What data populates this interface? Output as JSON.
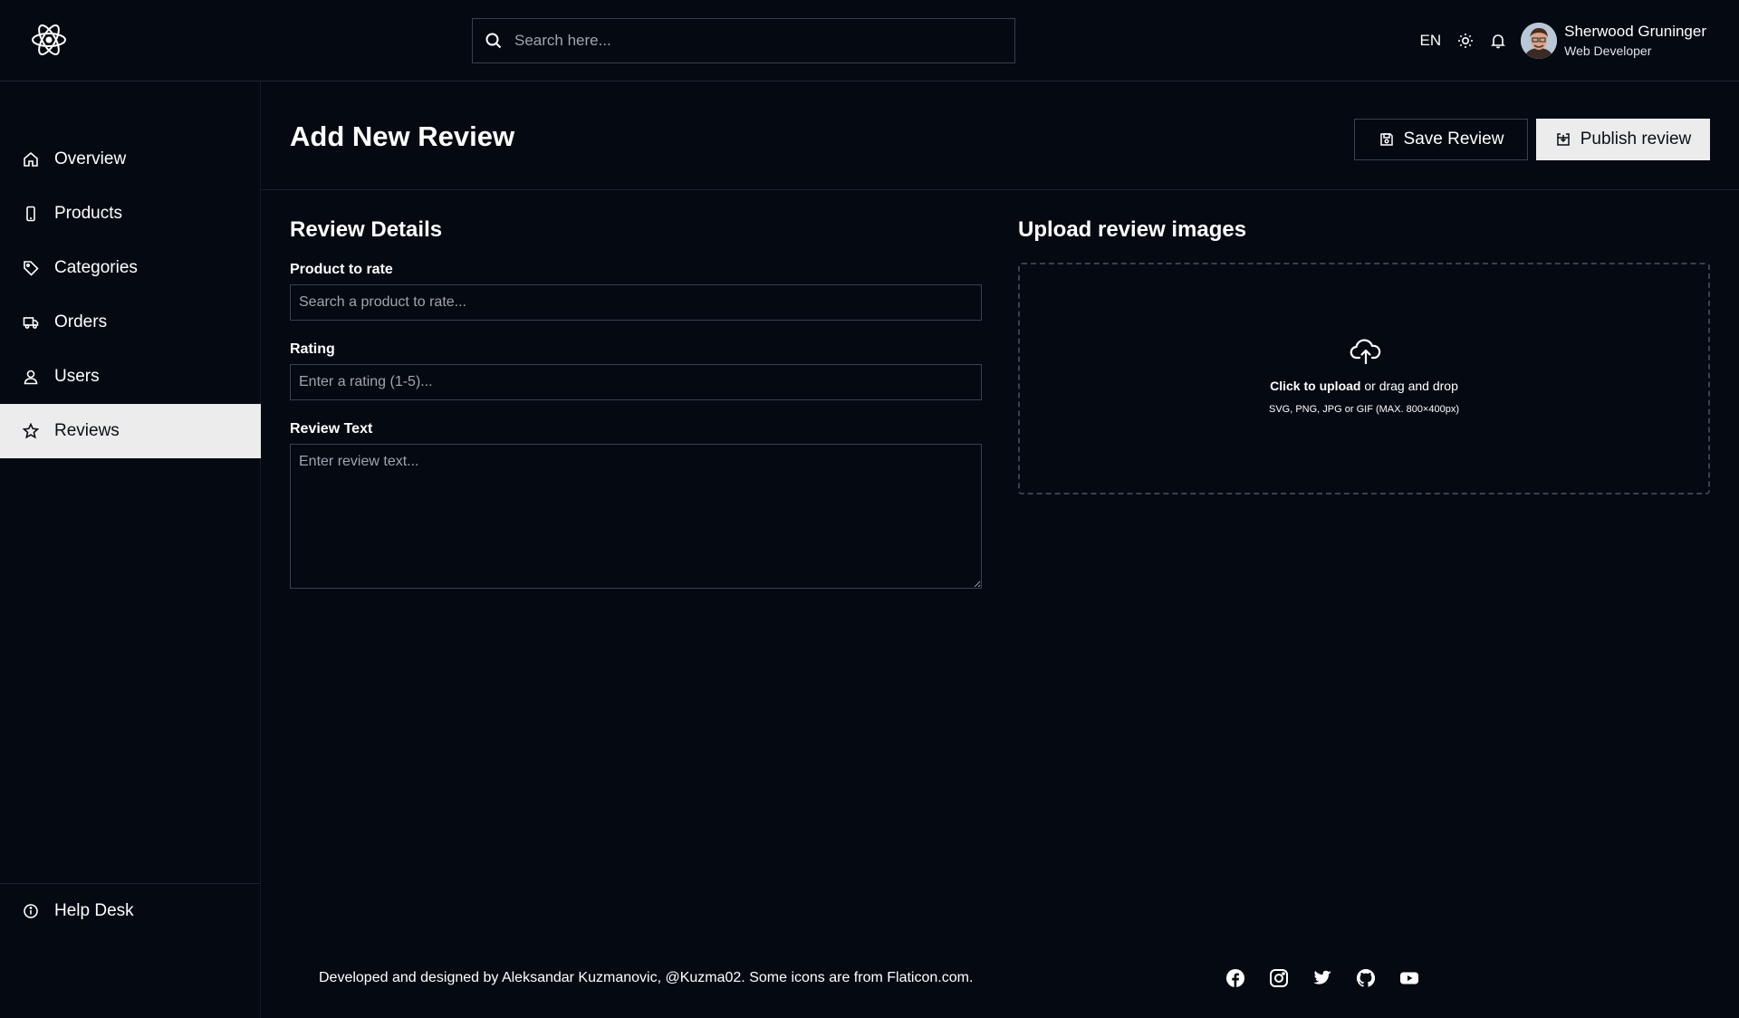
{
  "header": {
    "search_placeholder": "Search here...",
    "language": "EN",
    "user": {
      "name": "Sherwood Gruninger",
      "role": "Web Developer"
    }
  },
  "sidebar": {
    "items": [
      {
        "label": "Overview",
        "icon": "home-icon"
      },
      {
        "label": "Products",
        "icon": "phone-icon"
      },
      {
        "label": "Categories",
        "icon": "tag-icon"
      },
      {
        "label": "Orders",
        "icon": "truck-icon"
      },
      {
        "label": "Users",
        "icon": "user-icon"
      },
      {
        "label": "Reviews",
        "icon": "star-icon",
        "active": true
      }
    ],
    "help": {
      "label": "Help Desk",
      "icon": "info-icon"
    }
  },
  "main": {
    "title": "Add New Review",
    "save_label": "Save Review",
    "publish_label": "Publish review",
    "details": {
      "title": "Review Details",
      "product_label": "Product to rate",
      "product_placeholder": "Search a product to rate...",
      "rating_label": "Rating",
      "rating_placeholder": "Enter a rating (1-5)...",
      "text_label": "Review Text",
      "text_placeholder": "Enter review text..."
    },
    "upload": {
      "title": "Upload review images",
      "click_text": "Click to upload",
      "drag_text": " or drag and drop",
      "formats": "SVG, PNG, JPG or GIF (MAX. 800×400px)"
    }
  },
  "footer": {
    "credit": "Developed and designed by Aleksandar Kuzmanovic, @Kuzma02. Some icons are from Flaticon.com.",
    "socials": [
      "facebook-icon",
      "instagram-icon",
      "twitter-icon",
      "github-icon",
      "youtube-icon"
    ]
  },
  "colors": {
    "background": "#050912",
    "active_nav_bg": "#ececec",
    "border": "#3a4050"
  }
}
